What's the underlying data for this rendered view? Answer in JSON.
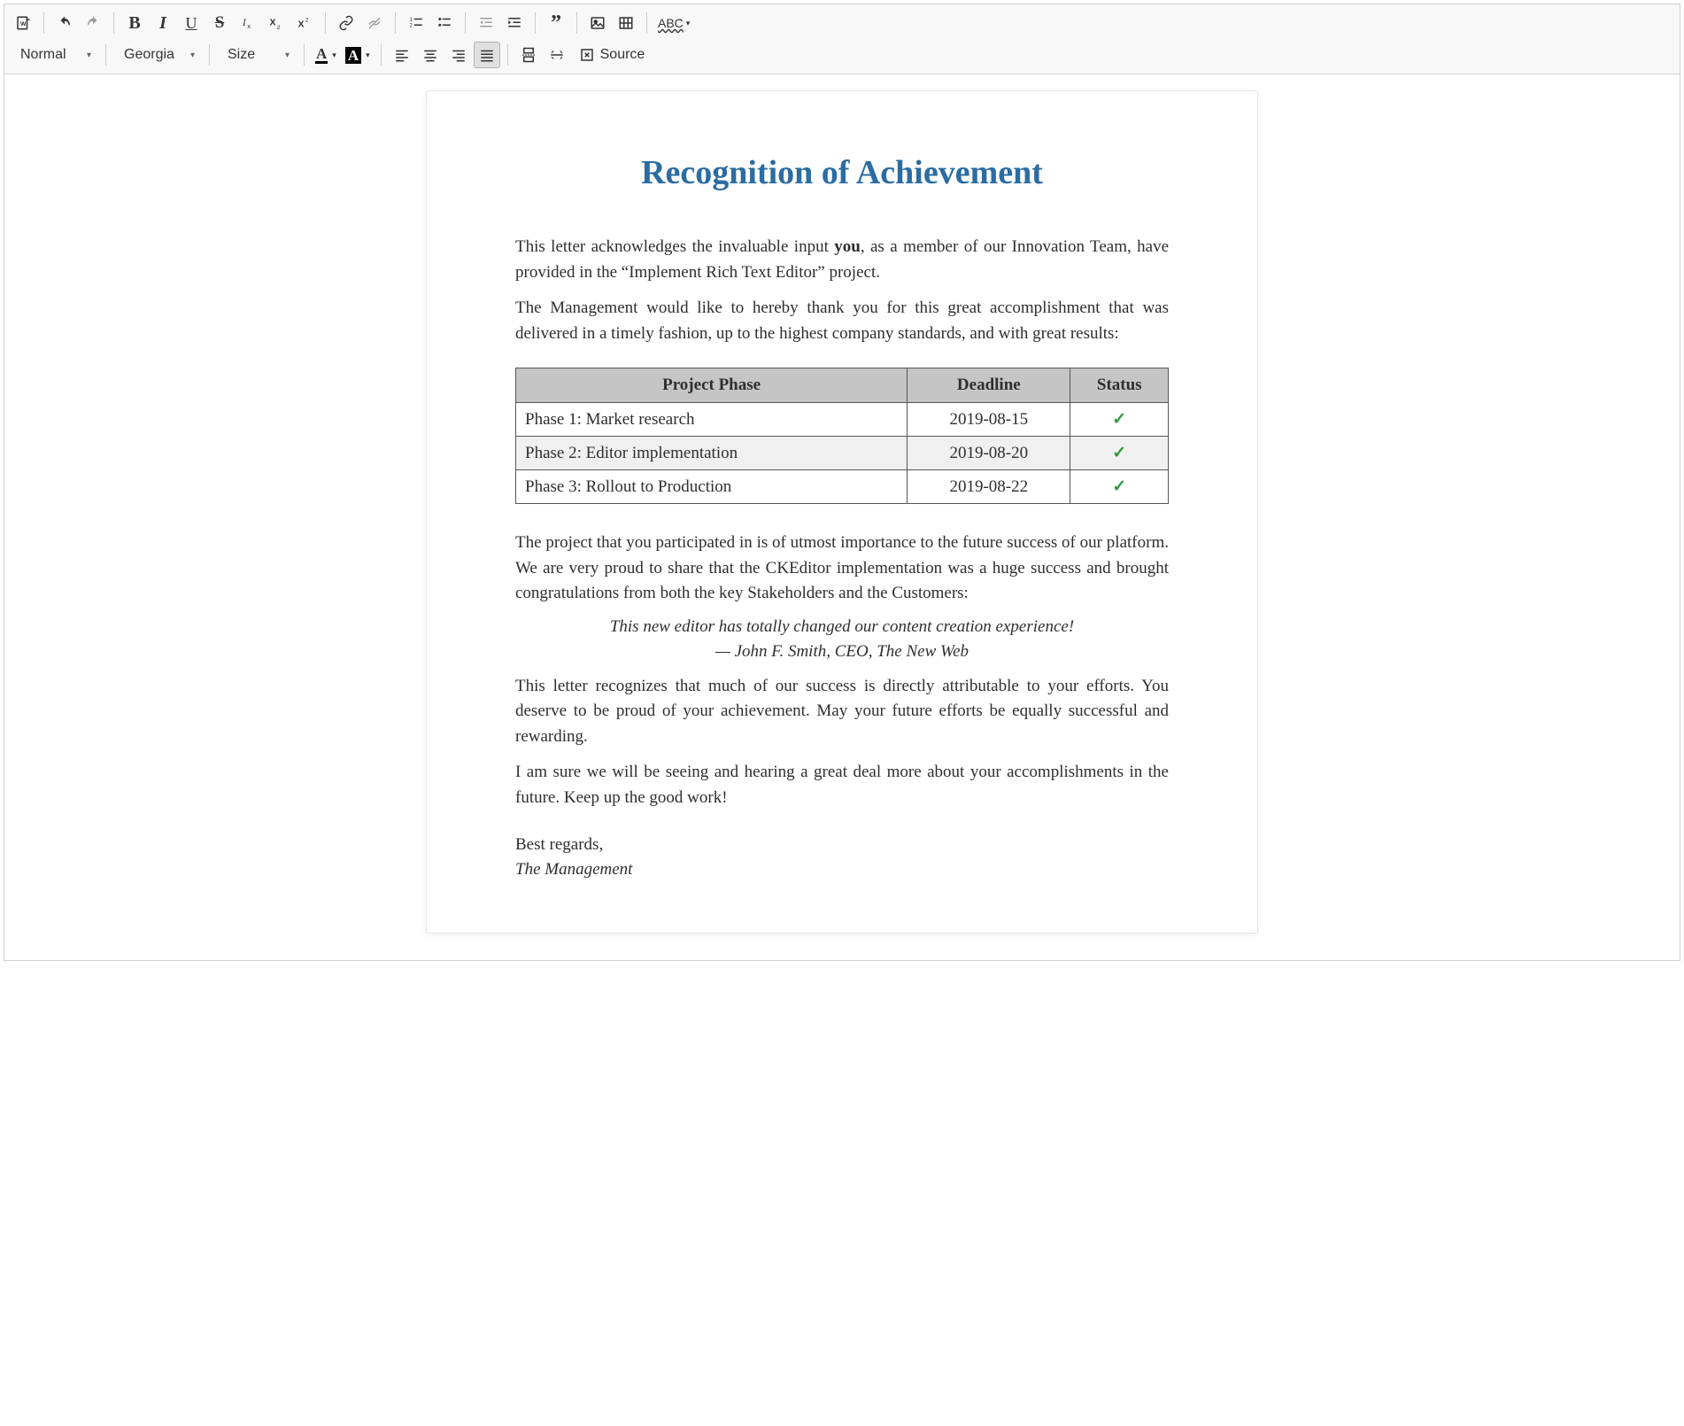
{
  "toolbar": {
    "format_select": "Normal",
    "font_select": "Georgia",
    "size_select": "Size",
    "source_label": "Source"
  },
  "document": {
    "title": "Recognition of Achievement",
    "p1_a": "This letter acknowledges the invaluable input ",
    "p1_bold": "you",
    "p1_b": ", as a member of our Innovation Team, have provided in the “Implement Rich Text Editor” project.",
    "p2": "The Management would like to hereby thank you for this great accomplishment that was delivered in a timely fashion, up to the highest company standards, and with great results:",
    "table": {
      "headers": {
        "phase": "Project Phase",
        "deadline": "Deadline",
        "status": "Status"
      },
      "rows": [
        {
          "phase": "Phase 1: Market research",
          "deadline": "2019-08-15",
          "status": "✓"
        },
        {
          "phase": "Phase 2: Editor implementation",
          "deadline": "2019-08-20",
          "status": "✓"
        },
        {
          "phase": "Phase 3: Rollout to Production",
          "deadline": "2019-08-22",
          "status": "✓"
        }
      ]
    },
    "p3": "The project that you participated in is of utmost importance to the future success of our platform. We are very proud to share that the CKEditor implementation was a huge success and brought congratulations from both the key Stakeholders and the Customers:",
    "quote": "This new editor has totally changed our content creation experience!",
    "quote_attr": "— John F. Smith, CEO, The New Web",
    "p4": "This letter recognizes that much of our success is directly attributable to your efforts. You deserve to be proud of your achievement. May your future efforts be equally successful and rewarding.",
    "p5": "I am sure we will be seeing and hearing a great deal more about your accomplishments in the future. Keep up the good work!",
    "signoff": "Best regards,",
    "signature": "The Management"
  }
}
